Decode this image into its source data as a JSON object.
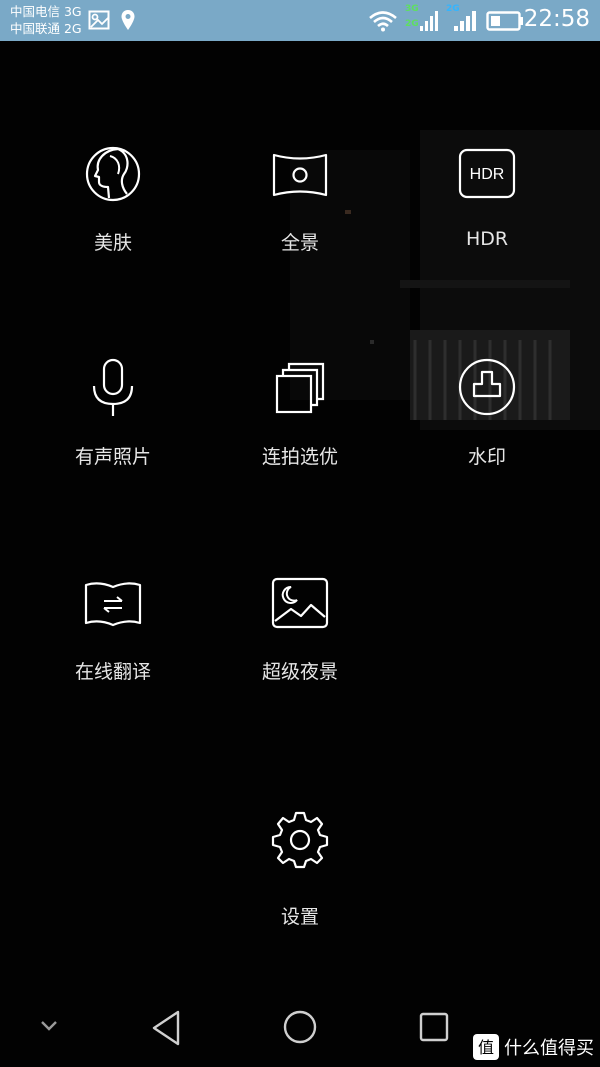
{
  "status_bar": {
    "carrier_1": "中国电信 3G",
    "carrier_2": "中国联通 2G",
    "net_3g": "3G",
    "net_2g_a": "2G",
    "net_2g_b": "2G",
    "time": "22:58",
    "accent_green": "#5ee05e",
    "accent_blue": "#33b5ff"
  },
  "modes": [
    {
      "label": "美肤",
      "icon": "face-icon"
    },
    {
      "label": "全景",
      "icon": "panorama-icon"
    },
    {
      "label": "HDR",
      "icon": "hdr-icon",
      "icon_text": "HDR"
    },
    {
      "label": "有声照片",
      "icon": "microphone-icon"
    },
    {
      "label": "连拍选优",
      "icon": "burst-stack-icon"
    },
    {
      "label": "水印",
      "icon": "stamp-icon"
    },
    {
      "label": "在线翻译",
      "icon": "book-translate-icon"
    },
    {
      "label": "超级夜景",
      "icon": "night-landscape-icon"
    }
  ],
  "settings": {
    "label": "设置",
    "icon": "gear-icon"
  },
  "nav": {
    "collapse": "chevron-down-icon",
    "back": "back-triangle-icon",
    "home": "home-circle-icon",
    "recent": "recent-square-icon"
  },
  "watermark": {
    "text": "什么值得买",
    "logo_char": "值"
  }
}
